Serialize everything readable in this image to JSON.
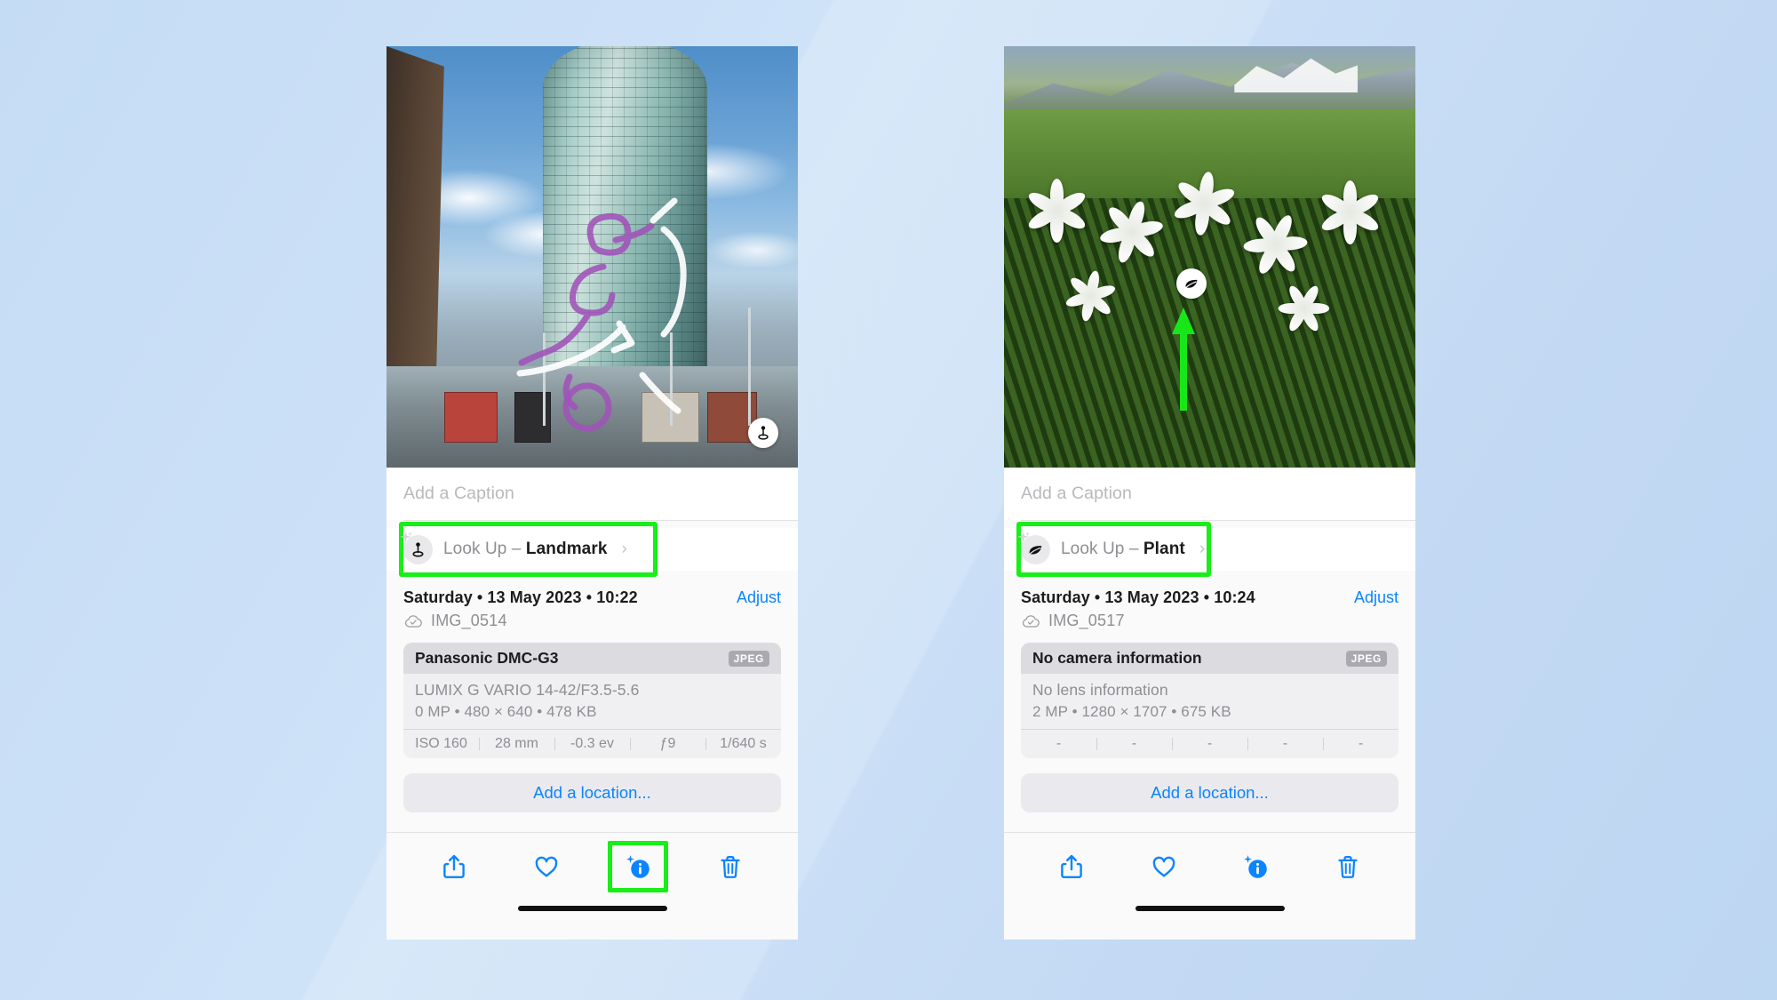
{
  "background": {
    "color_from": "#c5dcf5",
    "color_to": "#bdd6f2"
  },
  "accent": {
    "link": "#0a84ff",
    "highlight": "#18ee18",
    "muted_text": "#8e8e93"
  },
  "phones": [
    {
      "id": "left",
      "photo": {
        "subject": "architecture-tower",
        "badge_icon": "landmark-icon",
        "annotations": [
          "purple-scribble",
          "white-scribble"
        ]
      },
      "caption": {
        "placeholder": "Add a Caption",
        "value": ""
      },
      "lookup": {
        "icon": "landmark-icon",
        "label_prefix": "Look Up – ",
        "label_subject": "Landmark",
        "chevron": "›",
        "highlighted": true
      },
      "meta": {
        "date": "Saturday • 13 May 2023 • 10:22",
        "adjust_label": "Adjust",
        "cloud_icon": "icloud-check-icon",
        "filename": "IMG_0514"
      },
      "camera": {
        "model": "Panasonic DMC-G3",
        "format": "JPEG",
        "lens": "LUMIX G VARIO 14-42/F3.5-5.6",
        "size_line": "0 MP • 480 × 640 • 478 KB",
        "exif": [
          "ISO 160",
          "28 mm",
          "-0.3 ev",
          "ƒ9",
          "1/640 s"
        ]
      },
      "add_location": "Add a location...",
      "toolbar": {
        "items": [
          {
            "name": "share-icon",
            "label": "Share",
            "active": false,
            "highlighted": false
          },
          {
            "name": "heart-icon",
            "label": "Favourite",
            "active": false,
            "highlighted": false
          },
          {
            "name": "info-sparkle-icon",
            "label": "Info",
            "active": true,
            "highlighted": true
          },
          {
            "name": "trash-icon",
            "label": "Delete",
            "active": false,
            "highlighted": false
          }
        ]
      }
    },
    {
      "id": "right",
      "photo": {
        "subject": "alpine-flowers",
        "badge_icon": "leaf-icon",
        "annotations": [
          "green-arrow"
        ]
      },
      "caption": {
        "placeholder": "Add a Caption",
        "value": ""
      },
      "lookup": {
        "icon": "leaf-icon",
        "label_prefix": "Look Up – ",
        "label_subject": "Plant",
        "chevron": "›",
        "highlighted": true
      },
      "meta": {
        "date": "Saturday • 13 May 2023 • 10:24",
        "adjust_label": "Adjust",
        "cloud_icon": "icloud-check-icon",
        "filename": "IMG_0517"
      },
      "camera": {
        "model": "No camera information",
        "format": "JPEG",
        "lens": "No lens information",
        "size_line": "2 MP • 1280 × 1707 • 675 KB",
        "exif": [
          "-",
          "-",
          "-",
          "-",
          "-"
        ]
      },
      "add_location": "Add a location...",
      "toolbar": {
        "items": [
          {
            "name": "share-icon",
            "label": "Share",
            "active": false,
            "highlighted": false
          },
          {
            "name": "heart-icon",
            "label": "Favourite",
            "active": false,
            "highlighted": false
          },
          {
            "name": "info-sparkle-icon",
            "label": "Info",
            "active": true,
            "highlighted": false
          },
          {
            "name": "trash-icon",
            "label": "Delete",
            "active": false,
            "highlighted": false
          }
        ]
      }
    }
  ]
}
